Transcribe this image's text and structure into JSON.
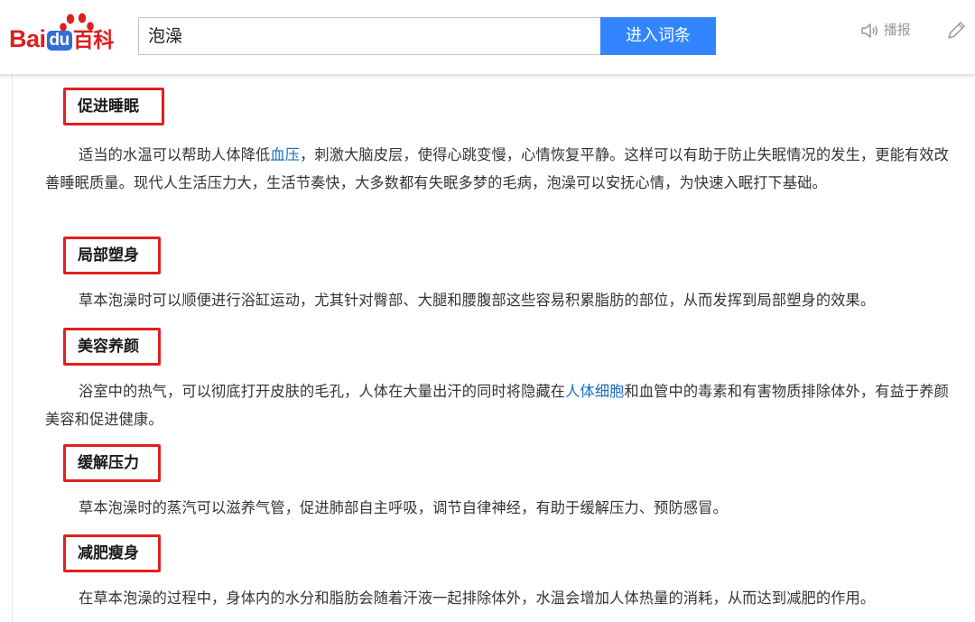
{
  "logo": {
    "bai": "Bai",
    "du": "du",
    "baike": "百科"
  },
  "search": {
    "query": "泡澡",
    "button": "进入词条"
  },
  "tools": {
    "speak_label": "播报",
    "edit_label": ""
  },
  "colors": {
    "brand_red": "#de1e1f",
    "brand_blue": "#2f6fd7",
    "button_blue": "#3385ff",
    "link_blue": "#136ec2",
    "highlight_box": "#e02020"
  },
  "sections": [
    {
      "title": "促进睡眠",
      "text_before": "适当的水温可以帮助人体降低",
      "link": "血压",
      "text_after": "，刺激大脑皮层，使得心跳变慢，心情恢复平静。这样可以有助于防止失眠情况的发生，更能有效改善睡眠质量。现代人生活压力大，生活节奏快，大多数都有失眠多梦的毛病，泡澡可以安抚心情，为快速入眠打下基础。"
    },
    {
      "title": "局部塑身",
      "text_before": "草本泡澡时可以顺便进行浴缸运动，尤其针对臀部、大腿和腰腹部这些容易积累脂肪的部位，从而发挥到局部塑身的效果。",
      "link": "",
      "text_after": ""
    },
    {
      "title": "美容养颜",
      "text_before": "浴室中的热气，可以彻底打开皮肤的毛孔，人体在大量出汗的同时将隐藏在",
      "link": "人体细胞",
      "text_after": "和血管中的毒素和有害物质排除体外，有益于养颜美容和促进健康。"
    },
    {
      "title": "缓解压力",
      "text_before": "草本泡澡时的蒸汽可以滋养气管，促进肺部自主呼吸，调节自律神经，有助于缓解压力、预防感冒。",
      "link": "",
      "text_after": ""
    },
    {
      "title": "减肥瘦身",
      "text_before": "在草本泡澡的过程中，身体内的水分和脂肪会随着汗液一起排除体外，水温会增加人体热量的消耗，从而达到减肥的作用。",
      "link": "",
      "text_after": ""
    }
  ]
}
